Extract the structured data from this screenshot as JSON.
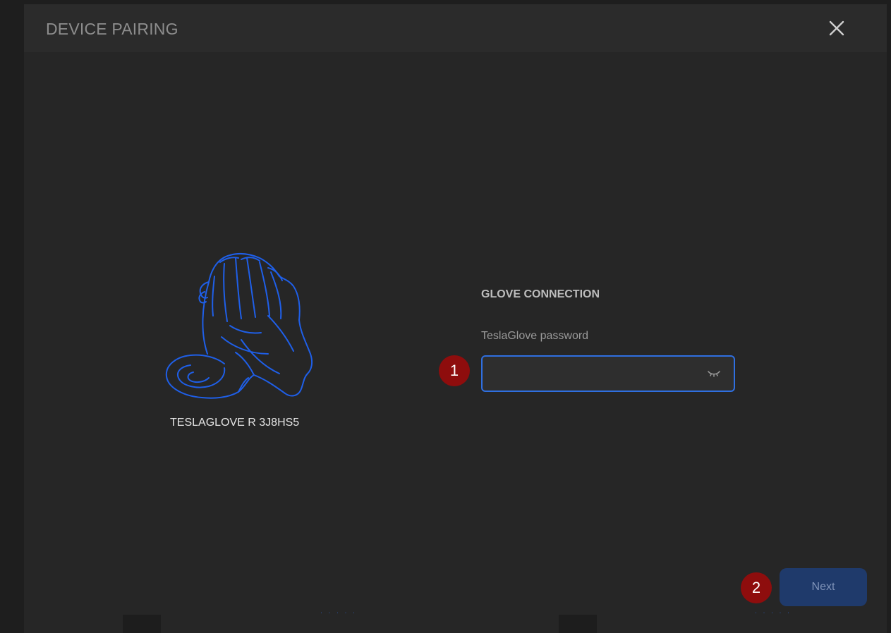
{
  "dialog": {
    "title": "DEVICE PAIRING",
    "close_icon": "close-icon"
  },
  "device": {
    "name": "TESLAGLOVE R 3J8HS5",
    "icon": "glove-outline-icon",
    "icon_color": "#1f5fe8"
  },
  "connection": {
    "section_title": "GLOVE CONNECTION",
    "password_label": "TeslaGlove password",
    "password_value": "",
    "password_placeholder": "",
    "reveal_icon": "eye-closed-icon"
  },
  "annotations": [
    {
      "number": "1"
    },
    {
      "number": "2"
    }
  ],
  "actions": {
    "next_label": "Next"
  },
  "colors": {
    "background": "#262626",
    "titlebar": "#2b2b2b",
    "accent": "#2f6fe0",
    "badge": "#8e0d0d",
    "button": "#1f3a6b"
  }
}
